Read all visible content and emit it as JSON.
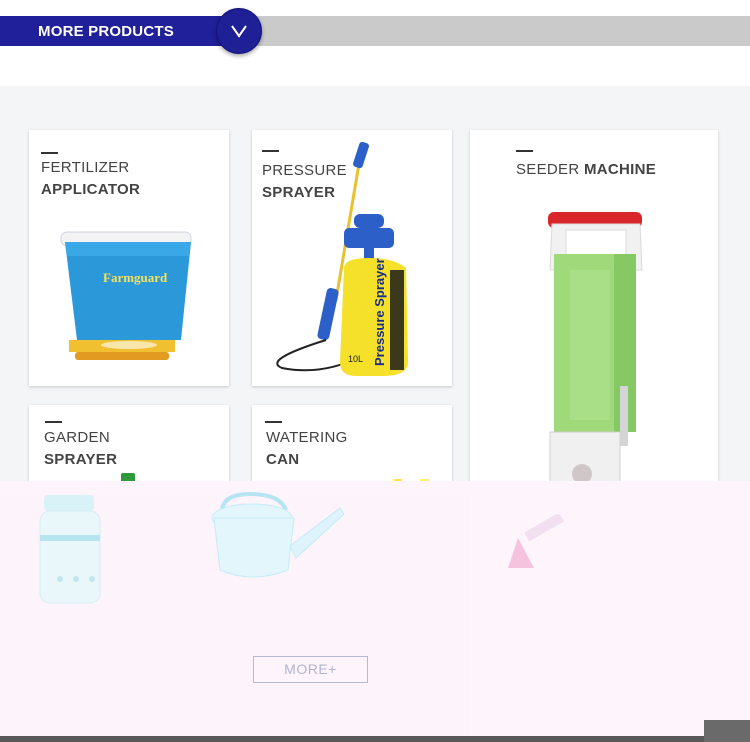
{
  "header": {
    "title": "MORE PRODUCTS"
  },
  "products": [
    {
      "line1": "FERTILIZER",
      "line2": "APPLICATOR",
      "brand": "Farmguard"
    },
    {
      "line1": "PRESSURE",
      "line2": "SPRAYER",
      "sprayer_text": "Pressure Sprayer",
      "capacity": "10L"
    },
    {
      "line1": "SEEDER",
      "line2": "MACHINE"
    },
    {
      "line1": "GARDEN",
      "line2": "SPRAYER"
    },
    {
      "line1": "WATERING",
      "line2": "CAN"
    }
  ],
  "more_button": "MORE+",
  "colors": {
    "brand_blue": "#20209a",
    "bar_gray": "#cacaca"
  }
}
